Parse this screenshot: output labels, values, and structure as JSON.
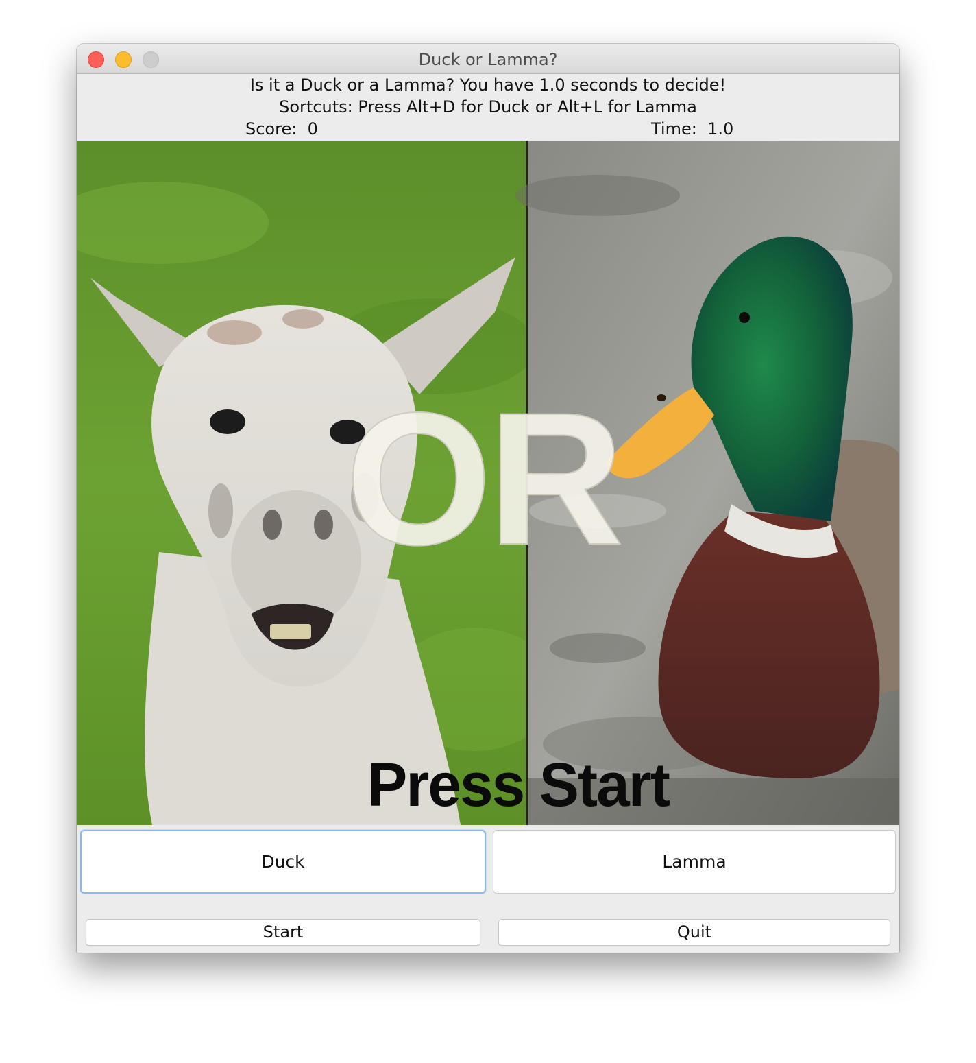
{
  "window": {
    "title": "Duck or Lamma?"
  },
  "header": {
    "prompt": "Is it a Duck or a Lamma? You have 1.0 seconds to decide!",
    "shortcuts": "Sortcuts: Press Alt+D for Duck or Alt+L for Lamma",
    "score_label": "Score:  0",
    "time_label": "Time:  1.0"
  },
  "canvas": {
    "or_text": "OR",
    "press_start_text": "Press Start",
    "left_image": "llama-photo",
    "right_image": "mallard-duck-photo"
  },
  "buttons": {
    "duck": "Duck",
    "lamma": "Lamma",
    "start": "Start",
    "quit": "Quit"
  },
  "colors": {
    "close": "#fc5f57",
    "minimize": "#fdbc2e",
    "zoom": "#cdcdcd",
    "focus_ring": "#8db8ea"
  }
}
